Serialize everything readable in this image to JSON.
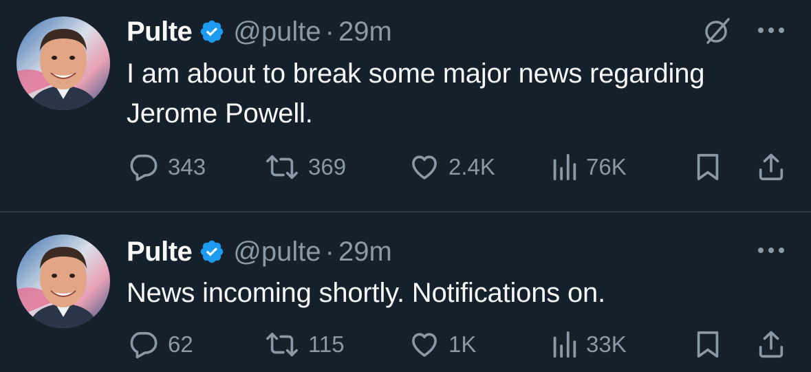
{
  "theme": {
    "background": "#15202b",
    "text": "#f7f9f9",
    "muted": "#8b98a5",
    "verified": "#1d9bf0",
    "divider": "#2f3d4a"
  },
  "tweets": [
    {
      "author": {
        "name": "Pulte",
        "handle": "@pulte",
        "verified": true
      },
      "separator": "·",
      "time": "29m",
      "text": "I am about to break some major news regarding Jerome Powell.",
      "extra_icon": "grok-slash-icon",
      "stats": {
        "replies": "343",
        "reposts": "369",
        "likes": "2.4K",
        "views": "76K"
      }
    },
    {
      "author": {
        "name": "Pulte",
        "handle": "@pulte",
        "verified": true
      },
      "separator": "·",
      "time": "29m",
      "text": "News incoming shortly. Notifications on.",
      "stats": {
        "replies": "62",
        "reposts": "115",
        "likes": "1K",
        "views": "33K"
      }
    }
  ]
}
